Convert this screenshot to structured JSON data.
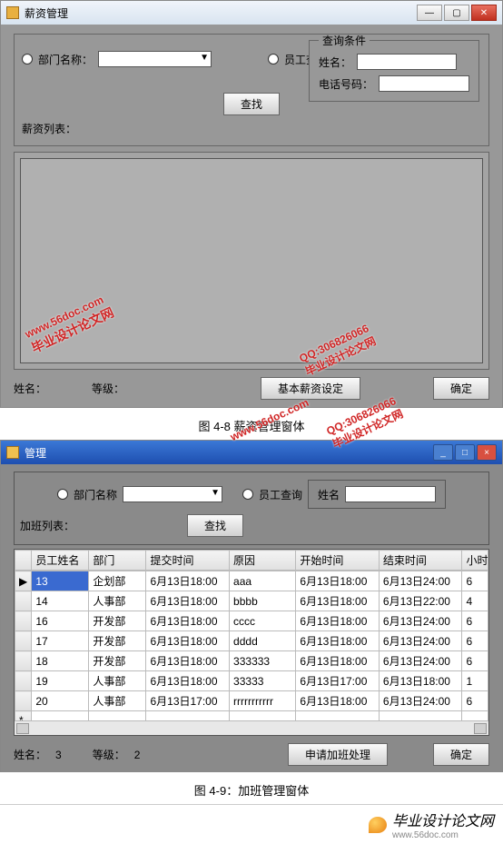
{
  "win1": {
    "title": "薪资管理",
    "dept_label": "部门名称：",
    "emp_label": "员工查询：",
    "query_group": "查询条件",
    "name_label": "姓名：",
    "phone_label": "电话号码：",
    "search_btn": "查找",
    "list_label": "薪资列表：",
    "status_name": "姓名：",
    "status_rank": "等级：",
    "settings_btn": "基本薪资设定",
    "ok_btn": "确定"
  },
  "caption1": "图 4-8 薪资管理窗体",
  "win2": {
    "title": "管理",
    "dept_label": "部门名称",
    "emp_label": "员工查询",
    "name_label": "姓名",
    "search_btn": "查找",
    "list_label": "加班列表：",
    "cols": [
      "员工姓名",
      "部门",
      "提交时间",
      "原因",
      "开始时间",
      "结束时间",
      "小时"
    ],
    "rows": [
      [
        "13",
        "企划部",
        "6月13日18:00",
        "aaa",
        "6月13日18:00",
        "6月13日24:00",
        "6"
      ],
      [
        "14",
        "人事部",
        "6月13日18:00",
        "bbbb",
        "6月13日18:00",
        "6月13日22:00",
        "4"
      ],
      [
        "16",
        "开发部",
        "6月13日18:00",
        "cccc",
        "6月13日18:00",
        "6月13日24:00",
        "6"
      ],
      [
        "17",
        "开发部",
        "6月13日18:00",
        "dddd",
        "6月13日18:00",
        "6月13日24:00",
        "6"
      ],
      [
        "18",
        "开发部",
        "6月13日18:00",
        "333333",
        "6月13日18:00",
        "6月13日24:00",
        "6"
      ],
      [
        "19",
        "人事部",
        "6月13日18:00",
        "33333",
        "6月13日17:00",
        "6月13日18:00",
        "1"
      ],
      [
        "20",
        "人事部",
        "6月13日17:00",
        "rrrrrrrrrrr",
        "6月13日18:00",
        "6月13日24:00",
        "6"
      ]
    ],
    "status_name": "姓名：",
    "status_name_v": "3",
    "status_rank": "等级：",
    "status_rank_v": "2",
    "apply_btn": "申请加班处理",
    "ok_btn": "确定"
  },
  "caption2": "图 4-9：加班管理窗体",
  "watermark": {
    "site": "www.56doc.com",
    "line2": "毕业设计论文网",
    "qq": "QQ:306826066"
  },
  "footer": {
    "text": "毕业设计论文网",
    "url": "www.56doc.com"
  }
}
